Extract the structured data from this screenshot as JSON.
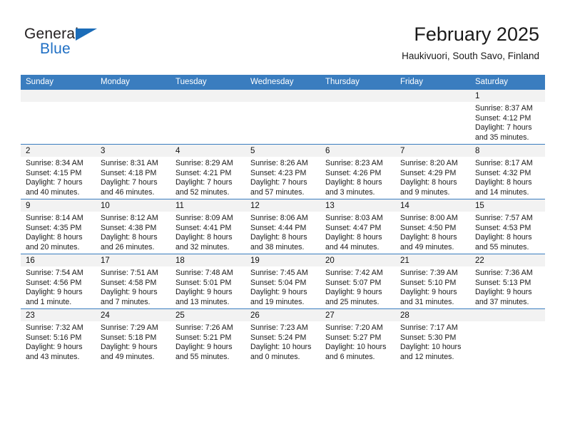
{
  "brand": {
    "word_one": "General",
    "word_two": "Blue",
    "triangle_icon": "triangle-icon"
  },
  "header": {
    "title": "February 2025",
    "location": "Haukivuori, South Savo, Finland"
  },
  "calendar": {
    "weekday_headers": [
      "Sunday",
      "Monday",
      "Tuesday",
      "Wednesday",
      "Thursday",
      "Friday",
      "Saturday"
    ],
    "accent_color": "#3a7dbf",
    "band_color": "#f2f2f2",
    "weeks": [
      [
        {
          "day": "",
          "empty": true
        },
        {
          "day": "",
          "empty": true
        },
        {
          "day": "",
          "empty": true
        },
        {
          "day": "",
          "empty": true
        },
        {
          "day": "",
          "empty": true
        },
        {
          "day": "",
          "empty": true
        },
        {
          "day": "1",
          "sunrise": "Sunrise: 8:37 AM",
          "sunset": "Sunset: 4:12 PM",
          "daylight_1": "Daylight: 7 hours",
          "daylight_2": "and 35 minutes."
        }
      ],
      [
        {
          "day": "2",
          "sunrise": "Sunrise: 8:34 AM",
          "sunset": "Sunset: 4:15 PM",
          "daylight_1": "Daylight: 7 hours",
          "daylight_2": "and 40 minutes."
        },
        {
          "day": "3",
          "sunrise": "Sunrise: 8:31 AM",
          "sunset": "Sunset: 4:18 PM",
          "daylight_1": "Daylight: 7 hours",
          "daylight_2": "and 46 minutes."
        },
        {
          "day": "4",
          "sunrise": "Sunrise: 8:29 AM",
          "sunset": "Sunset: 4:21 PM",
          "daylight_1": "Daylight: 7 hours",
          "daylight_2": "and 52 minutes."
        },
        {
          "day": "5",
          "sunrise": "Sunrise: 8:26 AM",
          "sunset": "Sunset: 4:23 PM",
          "daylight_1": "Daylight: 7 hours",
          "daylight_2": "and 57 minutes."
        },
        {
          "day": "6",
          "sunrise": "Sunrise: 8:23 AM",
          "sunset": "Sunset: 4:26 PM",
          "daylight_1": "Daylight: 8 hours",
          "daylight_2": "and 3 minutes."
        },
        {
          "day": "7",
          "sunrise": "Sunrise: 8:20 AM",
          "sunset": "Sunset: 4:29 PM",
          "daylight_1": "Daylight: 8 hours",
          "daylight_2": "and 9 minutes."
        },
        {
          "day": "8",
          "sunrise": "Sunrise: 8:17 AM",
          "sunset": "Sunset: 4:32 PM",
          "daylight_1": "Daylight: 8 hours",
          "daylight_2": "and 14 minutes."
        }
      ],
      [
        {
          "day": "9",
          "sunrise": "Sunrise: 8:14 AM",
          "sunset": "Sunset: 4:35 PM",
          "daylight_1": "Daylight: 8 hours",
          "daylight_2": "and 20 minutes."
        },
        {
          "day": "10",
          "sunrise": "Sunrise: 8:12 AM",
          "sunset": "Sunset: 4:38 PM",
          "daylight_1": "Daylight: 8 hours",
          "daylight_2": "and 26 minutes."
        },
        {
          "day": "11",
          "sunrise": "Sunrise: 8:09 AM",
          "sunset": "Sunset: 4:41 PM",
          "daylight_1": "Daylight: 8 hours",
          "daylight_2": "and 32 minutes."
        },
        {
          "day": "12",
          "sunrise": "Sunrise: 8:06 AM",
          "sunset": "Sunset: 4:44 PM",
          "daylight_1": "Daylight: 8 hours",
          "daylight_2": "and 38 minutes."
        },
        {
          "day": "13",
          "sunrise": "Sunrise: 8:03 AM",
          "sunset": "Sunset: 4:47 PM",
          "daylight_1": "Daylight: 8 hours",
          "daylight_2": "and 44 minutes."
        },
        {
          "day": "14",
          "sunrise": "Sunrise: 8:00 AM",
          "sunset": "Sunset: 4:50 PM",
          "daylight_1": "Daylight: 8 hours",
          "daylight_2": "and 49 minutes."
        },
        {
          "day": "15",
          "sunrise": "Sunrise: 7:57 AM",
          "sunset": "Sunset: 4:53 PM",
          "daylight_1": "Daylight: 8 hours",
          "daylight_2": "and 55 minutes."
        }
      ],
      [
        {
          "day": "16",
          "sunrise": "Sunrise: 7:54 AM",
          "sunset": "Sunset: 4:56 PM",
          "daylight_1": "Daylight: 9 hours",
          "daylight_2": "and 1 minute."
        },
        {
          "day": "17",
          "sunrise": "Sunrise: 7:51 AM",
          "sunset": "Sunset: 4:58 PM",
          "daylight_1": "Daylight: 9 hours",
          "daylight_2": "and 7 minutes."
        },
        {
          "day": "18",
          "sunrise": "Sunrise: 7:48 AM",
          "sunset": "Sunset: 5:01 PM",
          "daylight_1": "Daylight: 9 hours",
          "daylight_2": "and 13 minutes."
        },
        {
          "day": "19",
          "sunrise": "Sunrise: 7:45 AM",
          "sunset": "Sunset: 5:04 PM",
          "daylight_1": "Daylight: 9 hours",
          "daylight_2": "and 19 minutes."
        },
        {
          "day": "20",
          "sunrise": "Sunrise: 7:42 AM",
          "sunset": "Sunset: 5:07 PM",
          "daylight_1": "Daylight: 9 hours",
          "daylight_2": "and 25 minutes."
        },
        {
          "day": "21",
          "sunrise": "Sunrise: 7:39 AM",
          "sunset": "Sunset: 5:10 PM",
          "daylight_1": "Daylight: 9 hours",
          "daylight_2": "and 31 minutes."
        },
        {
          "day": "22",
          "sunrise": "Sunrise: 7:36 AM",
          "sunset": "Sunset: 5:13 PM",
          "daylight_1": "Daylight: 9 hours",
          "daylight_2": "and 37 minutes."
        }
      ],
      [
        {
          "day": "23",
          "sunrise": "Sunrise: 7:32 AM",
          "sunset": "Sunset: 5:16 PM",
          "daylight_1": "Daylight: 9 hours",
          "daylight_2": "and 43 minutes."
        },
        {
          "day": "24",
          "sunrise": "Sunrise: 7:29 AM",
          "sunset": "Sunset: 5:18 PM",
          "daylight_1": "Daylight: 9 hours",
          "daylight_2": "and 49 minutes."
        },
        {
          "day": "25",
          "sunrise": "Sunrise: 7:26 AM",
          "sunset": "Sunset: 5:21 PM",
          "daylight_1": "Daylight: 9 hours",
          "daylight_2": "and 55 minutes."
        },
        {
          "day": "26",
          "sunrise": "Sunrise: 7:23 AM",
          "sunset": "Sunset: 5:24 PM",
          "daylight_1": "Daylight: 10 hours",
          "daylight_2": "and 0 minutes."
        },
        {
          "day": "27",
          "sunrise": "Sunrise: 7:20 AM",
          "sunset": "Sunset: 5:27 PM",
          "daylight_1": "Daylight: 10 hours",
          "daylight_2": "and 6 minutes."
        },
        {
          "day": "28",
          "sunrise": "Sunrise: 7:17 AM",
          "sunset": "Sunset: 5:30 PM",
          "daylight_1": "Daylight: 10 hours",
          "daylight_2": "and 12 minutes."
        },
        {
          "day": "",
          "empty": true
        }
      ]
    ]
  }
}
